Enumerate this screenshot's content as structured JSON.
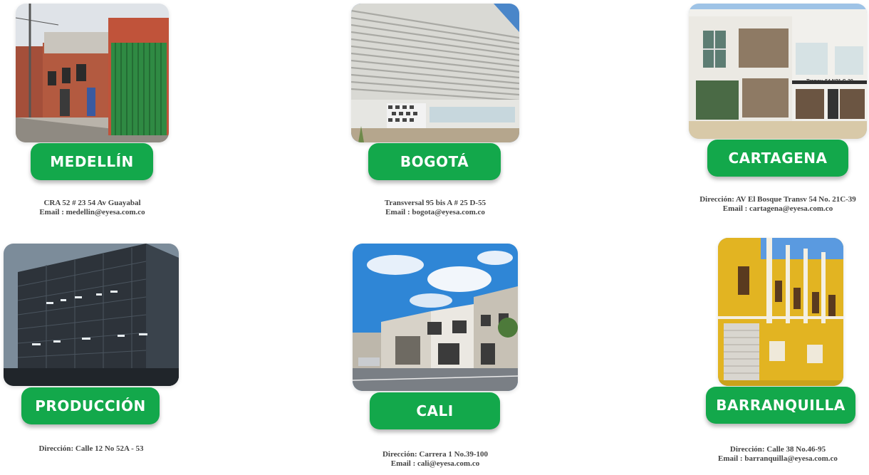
{
  "colors": {
    "pill_green": "#13a84b",
    "text_gray": "#444444"
  },
  "offices": [
    {
      "name": "MEDELLÍN",
      "address": "CRA 52 # 23 54 Av Guayabal",
      "email": "Email : medellin@eyesa.com.co"
    },
    {
      "name": "BOGOTÁ",
      "address": "Transversal 95 bis A # 25 D-55",
      "email": "Email : bogota@eyesa.com.co"
    },
    {
      "name": "CARTAGENA",
      "address": "Dirección: AV El Bosque Transv 54 No. 21C-39",
      "email": "Email :   cartagena@eyesa.com.co"
    },
    {
      "name": "PRODUCCIÓN",
      "address": "Dirección: Calle 12 No 52A - 53",
      "email": ""
    },
    {
      "name": "CALI",
      "address": "Dirección: Carrera 1 No.39-100",
      "email": "Email : cali@eyesa.com.co"
    },
    {
      "name": "BARRANQUILLA",
      "address": "Dirección: Calle 38 No.46-95",
      "email": "Email : barranquilla@eyesa.com.co"
    }
  ],
  "photo_signs": {
    "cartagena": "Transv. 54 N21 C-39"
  }
}
